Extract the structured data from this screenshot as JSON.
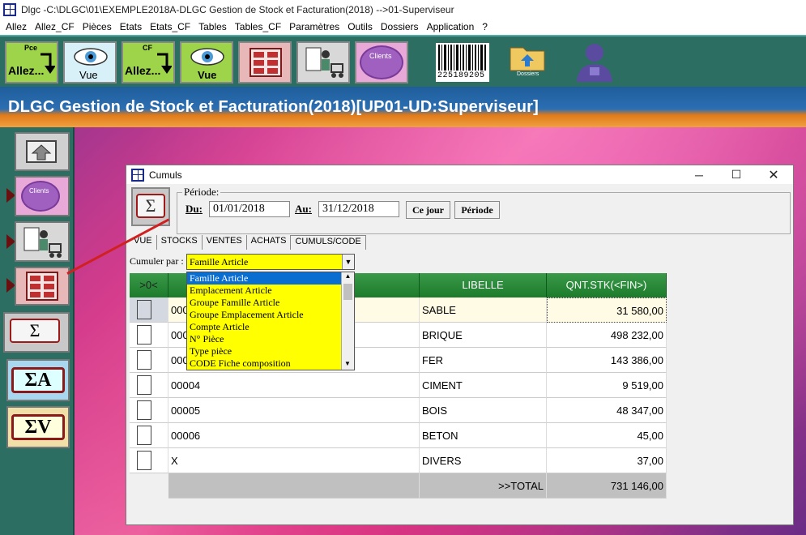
{
  "window": {
    "title": "Dlgc -C:\\DLGC\\01\\EXEMPLE2018A-DLGC Gestion de Stock et Facturation(2018) -->01-Superviseur"
  },
  "menu": [
    "Allez",
    "Allez_CF",
    "Pièces",
    "Etats",
    "Etats_CF",
    "Tables",
    "Tables_CF",
    "Paramètres",
    "Outils",
    "Dossiers",
    "Application",
    "?"
  ],
  "toolbar": {
    "allez_pce_top": "Pce",
    "allez_pce_label": "Allez...",
    "vue1_label": "Vue",
    "allez_cf_top": "CF",
    "allez_cf_label": "Allez...",
    "vue2_label": "Vue",
    "clients_label": "Clients",
    "barcode_number": "225189205",
    "dossiers_label": "Dossiers"
  },
  "header": {
    "title": "DLGC Gestion de Stock et Facturation(2018)[UP01-UD:Superviseur]"
  },
  "leftpanel": {
    "clients_label": "Clients",
    "sigma_label": "Σ",
    "sigma_a_label": "ΣA",
    "sigma_v_label": "ΣV"
  },
  "dialog": {
    "title": "Cumuls",
    "sigma": "Σ",
    "periode_label": "Période:",
    "du_label": "Du:",
    "du_value": "01/01/2018",
    "au_label": "Au:",
    "au_value": "31/12/2018",
    "cejour_label": "Ce jour",
    "periode_button": "Période",
    "tabs": [
      "VUE",
      "STOCKS",
      "VENTES",
      "ACHATS",
      "CUMULS/CODE"
    ],
    "cumuler_label": "Cumuler par :",
    "cumuler_value": "Famille Article",
    "dropdown_options": [
      "Famille Article",
      "Emplacement Article",
      "Groupe Famille Article",
      "Groupe Emplacement Article",
      "Compte Article",
      "N° Pièce",
      "Type pièce",
      "CODE Fiche composition"
    ],
    "columns": {
      "check": ">0<",
      "code": "",
      "libelle": "LIBELLE",
      "qnt": "QNT.STK(<FIN>)"
    },
    "rows": [
      {
        "code": "000",
        "libelle": "SABLE",
        "qnt": "31 580,00"
      },
      {
        "code": "000",
        "libelle": "BRIQUE",
        "qnt": "498 232,00"
      },
      {
        "code": "000",
        "libelle": "FER",
        "qnt": "143 386,00"
      },
      {
        "code": "00004",
        "libelle": "CIMENT",
        "qnt": "9 519,00"
      },
      {
        "code": "00005",
        "libelle": "BOIS",
        "qnt": "48 347,00"
      },
      {
        "code": "00006",
        "libelle": "BETON",
        "qnt": "45,00"
      },
      {
        "code": "X",
        "libelle": "DIVERS",
        "qnt": "37,00"
      }
    ],
    "total_label": ">>TOTAL",
    "total_value": "731 146,00"
  }
}
